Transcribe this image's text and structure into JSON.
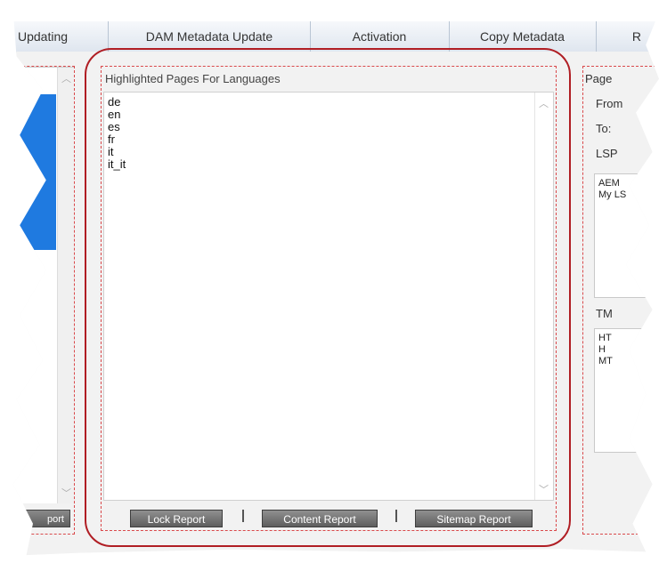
{
  "tabs": [
    {
      "label": "Updating"
    },
    {
      "label": "DAM Metadata Update"
    },
    {
      "label": "Activation"
    },
    {
      "label": "Copy Metadata"
    },
    {
      "label": "R"
    }
  ],
  "left_panel": {
    "button_label": "port"
  },
  "center_panel": {
    "header": "Highlighted Pages For Languages",
    "languages": [
      "de",
      "en",
      "es",
      "fr",
      "it",
      "it_it"
    ],
    "buttons": {
      "lock": "Lock Report",
      "content": "Content Report",
      "sitemap": "Sitemap Report"
    }
  },
  "right_panel": {
    "title": "Page",
    "from_label": "From",
    "to_label": "To:",
    "lsp_label": "LSP",
    "lsp_items": [
      "AEM",
      "My LS"
    ],
    "tm_label": "TM",
    "tm_items": [
      "HT",
      "H",
      "MT"
    ]
  },
  "colors": {
    "highlight": "#b01e24",
    "selection": "#1f7ae0"
  }
}
